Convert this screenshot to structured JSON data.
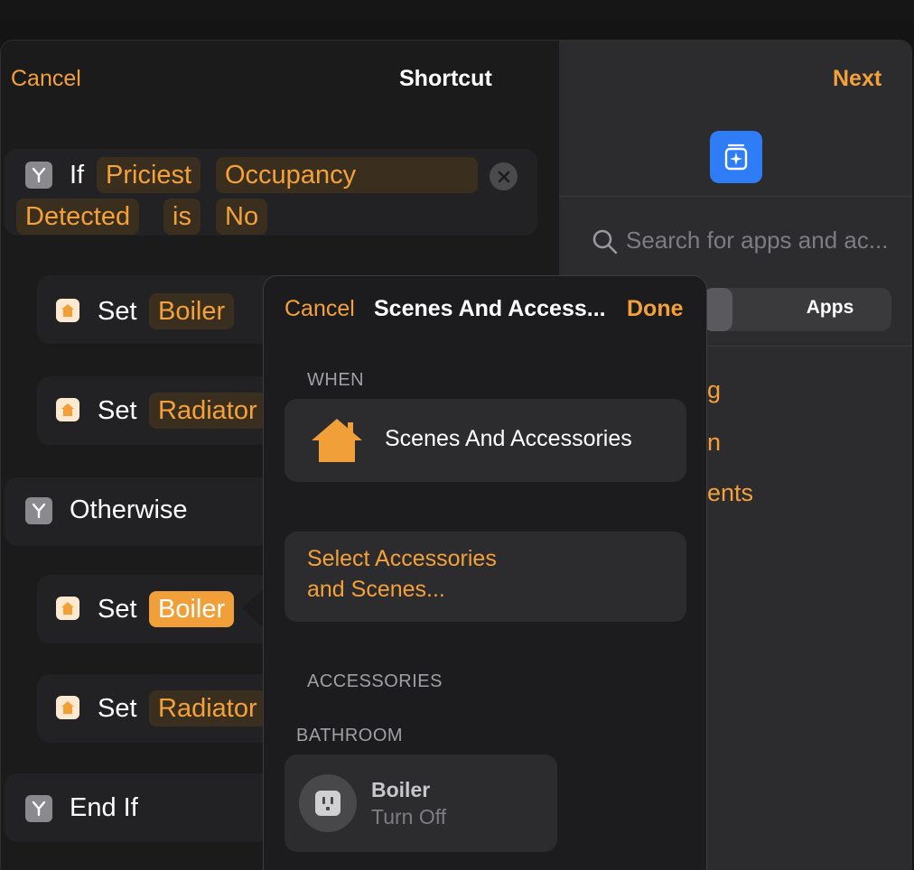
{
  "nav": {
    "cancel": "Cancel",
    "title": "Shortcut",
    "next": "Next"
  },
  "if_block": {
    "if": "If",
    "tokens": [
      "Priciest",
      "Occupancy",
      "Detected",
      "is",
      "No"
    ]
  },
  "actions": [
    {
      "verb": "Set",
      "target": "Boiler"
    },
    {
      "verb": "Set",
      "target": "Radiator"
    },
    {
      "verb": "Set",
      "target": "Boiler"
    },
    {
      "verb": "Set",
      "target": "Radiator"
    }
  ],
  "otherwise": "Otherwise",
  "end_if": "End If",
  "right_panel": {
    "search_placeholder": "Search for apps and ac...",
    "segment_apps": "Apps",
    "peek_items": [
      "g",
      "n",
      "ents"
    ]
  },
  "popover": {
    "cancel": "Cancel",
    "title": "Scenes And Access...",
    "done": "Done",
    "when_header": "WHEN",
    "when_item": "Scenes And Accessories",
    "select_line1": "Select Accessories",
    "select_line2": "and Scenes...",
    "accessories_header": "ACCESSORIES",
    "room_header": "BATHROOM",
    "accessory_name": "Boiler",
    "accessory_state": "Turn Off"
  },
  "colors": {
    "accent": "#f5a13a",
    "app_icon_blue": "#2e7cf6"
  }
}
